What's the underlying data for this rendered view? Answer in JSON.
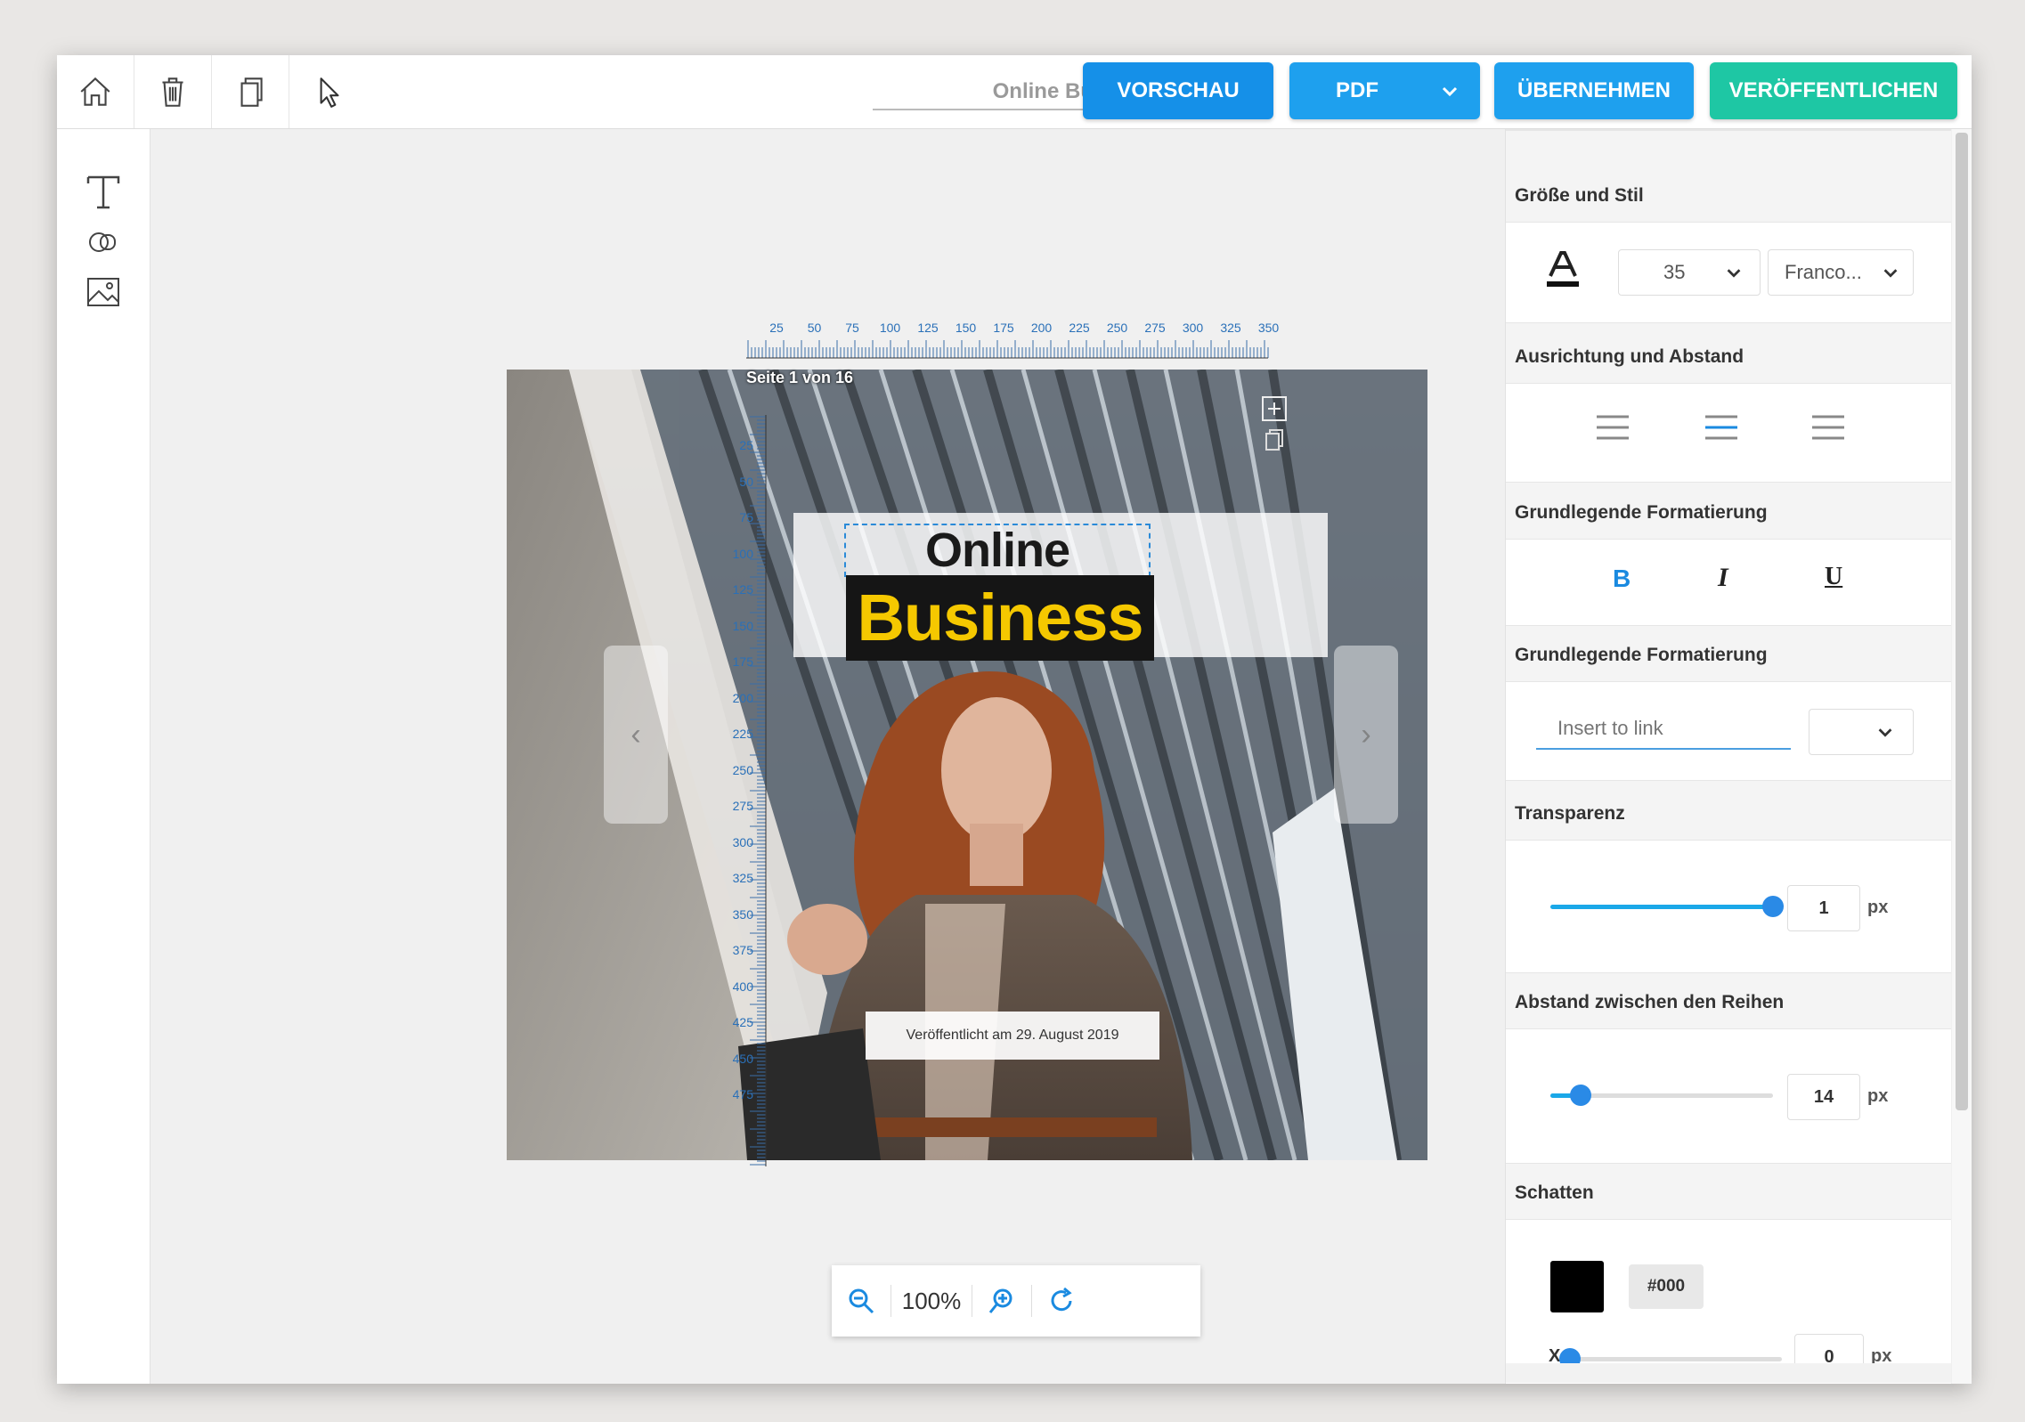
{
  "toolbar": {
    "doc_title": "Online Busine",
    "preview_label": "VORSCHAU",
    "pdf_label": "PDF",
    "apply_label": "ÜBERNEHMEN",
    "publish_label": "VERÖFFENTLICHEN"
  },
  "canvas": {
    "page_label": "Seite 1 von 16",
    "title_line1": "Online",
    "title_line2": "Business",
    "date_text": "Veröffentlicht am 29. August 2019",
    "ruler_h": [
      "25",
      "50",
      "75",
      "100",
      "125",
      "150",
      "175",
      "200",
      "225",
      "250",
      "275",
      "300",
      "325",
      "350"
    ],
    "ruler_v": [
      "25",
      "50",
      "75",
      "100",
      "125",
      "150",
      "175",
      "200",
      "225",
      "250",
      "275",
      "300",
      "325",
      "350",
      "375",
      "400",
      "425",
      "450",
      "475"
    ],
    "prev_arrow": "‹",
    "next_arrow": "›"
  },
  "zoom": {
    "level": "100%"
  },
  "panel": {
    "size_style": {
      "heading": "Größe und Stil",
      "font_size": "35",
      "font_name": "Franco..."
    },
    "alignment": {
      "heading": "Ausrichtung und Abstand"
    },
    "basic_format": {
      "heading": "Grundlegende Formatierung",
      "bold": "B",
      "italic": "I",
      "underline": "U"
    },
    "link": {
      "heading": "Grundlegende Formatierung",
      "placeholder": "Insert to link"
    },
    "transparency": {
      "heading": "Transparenz",
      "value": "1",
      "unit": "px",
      "level": 1.0
    },
    "line_spacing": {
      "heading": "Abstand zwischen den Reihen",
      "value": "14",
      "unit": "px",
      "level": 0.14
    },
    "shadow": {
      "heading": "Schatten",
      "color": "#000",
      "color_label": "#000",
      "x_label": "X",
      "x_value": "0",
      "x_unit": "px"
    }
  },
  "colors": {
    "primary": "#1590e8",
    "accent_blue": "#1ea0ee",
    "publish_green": "#1ec7a4",
    "title_yellow": "#f5c800"
  }
}
